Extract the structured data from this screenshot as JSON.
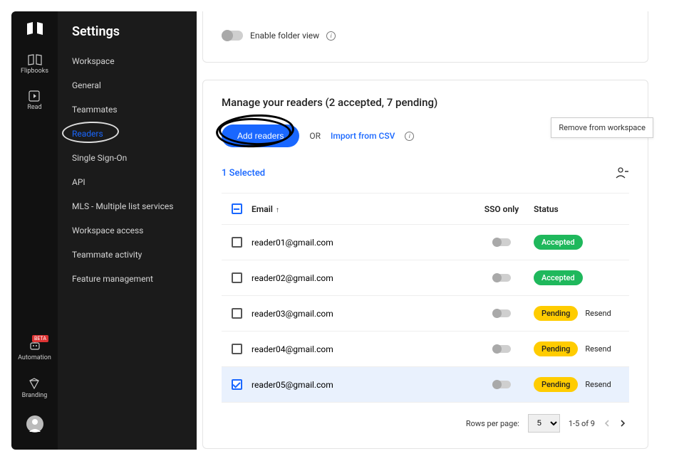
{
  "rail": {
    "items": [
      {
        "label": "Flipbooks"
      },
      {
        "label": "Read"
      }
    ],
    "bottom": [
      {
        "label": "Automation",
        "beta": "BETA"
      },
      {
        "label": "Branding"
      }
    ]
  },
  "sidebar": {
    "title": "Settings",
    "items": [
      {
        "label": "Workspace"
      },
      {
        "label": "General"
      },
      {
        "label": "Teammates"
      },
      {
        "label": "Readers",
        "active": true
      },
      {
        "label": "Single Sign-On"
      },
      {
        "label": "API"
      },
      {
        "label": "MLS - Multiple list services"
      },
      {
        "label": "Workspace access"
      },
      {
        "label": "Teammate activity"
      },
      {
        "label": "Feature management"
      }
    ]
  },
  "top_card": {
    "folder_label": "Enable folder view"
  },
  "readers": {
    "title": "Manage your readers (2 accepted, 7 pending)",
    "add_label": "Add readers",
    "or": "OR",
    "import_label": "Import from CSV",
    "tooltip": "Remove from workspace",
    "selected_text": "1 Selected",
    "columns": {
      "email": "Email",
      "sso": "SSO only",
      "status": "Status"
    },
    "rows": [
      {
        "email": "reader01@gmail.com",
        "status": "Accepted",
        "resend": false,
        "checked": false
      },
      {
        "email": "reader02@gmail.com",
        "status": "Accepted",
        "resend": false,
        "checked": false
      },
      {
        "email": "reader03@gmail.com",
        "status": "Pending",
        "resend": true,
        "checked": false
      },
      {
        "email": "reader04@gmail.com",
        "status": "Pending",
        "resend": true,
        "checked": false
      },
      {
        "email": "reader05@gmail.com",
        "status": "Pending",
        "resend": true,
        "checked": true
      }
    ],
    "resend_label": "Resend",
    "pager": {
      "rpp_label": "Rows per page:",
      "rpp": "5",
      "range": "1-5 of 9"
    }
  }
}
